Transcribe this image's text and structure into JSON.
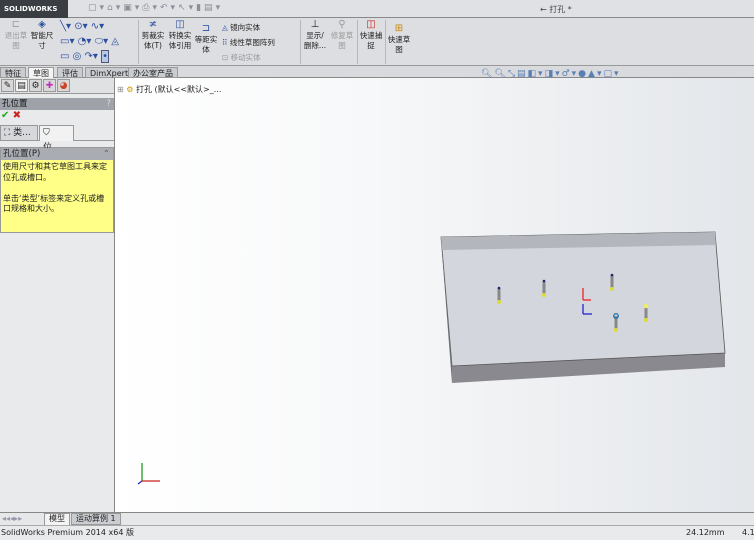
{
  "app": {
    "logo": "SOLIDWORKS",
    "document_title": "← 打孔 *"
  },
  "quick_access": [
    "new",
    "open",
    "save",
    "print",
    "undo",
    "select",
    "rebuild",
    "options"
  ],
  "ribbon": {
    "exit_sketch": "退出草图",
    "smart_dimension": "智能尺寸",
    "trim": "剪裁实体(T)",
    "convert": "转换实体引用",
    "offset": "等距实体",
    "mirror": "镜向实体",
    "linear_pattern": "线性草图阵列",
    "move": "移动实体",
    "show_delete": "显示/删除...",
    "repair": "修复草图",
    "quick_snap": "快速捕捉",
    "rapid_sketch": "快速草图"
  },
  "tabs": [
    "特征",
    "草图",
    "评估",
    "DimXpert",
    "办公室产品"
  ],
  "active_tab": 1,
  "panel": {
    "title": "孔位置",
    "subtabs": [
      "类...",
      "位..."
    ],
    "group_title": "孔位置(P)",
    "help_p1": "使用尺寸和其它草图工具来定位孔或槽口。",
    "help_p2": "单击‘类型’标签来定义孔或槽口规格和大小。"
  },
  "tree": {
    "item": "打孔 (默认<<默认>_..."
  },
  "bottom_tabs": [
    "模型",
    "运动算例 1"
  ],
  "status": {
    "product": "SolidWorks Premium 2014 x64 版",
    "measure": "24.12mm",
    "extra": "4.1"
  },
  "colors": {
    "help_bg": "#ffff88",
    "accent": "#2a4ea0"
  }
}
